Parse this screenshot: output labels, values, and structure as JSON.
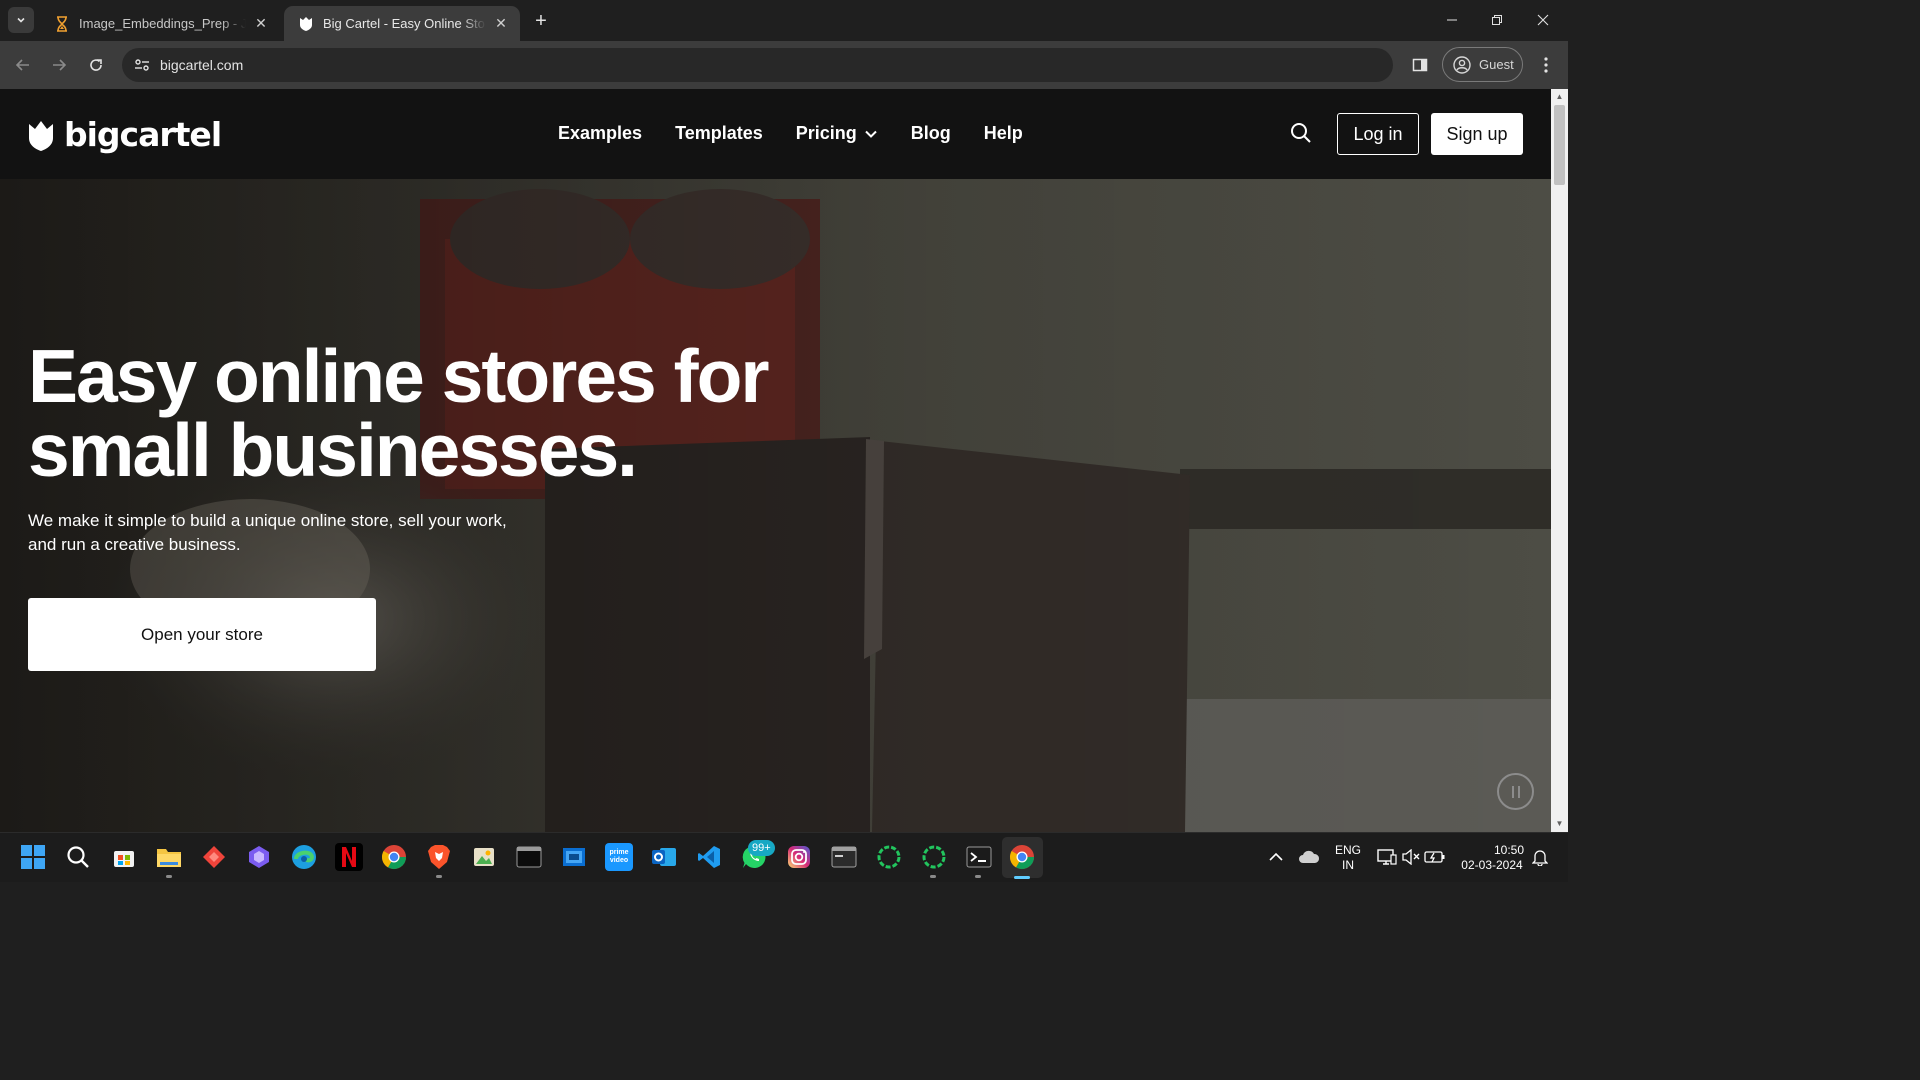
{
  "browser": {
    "tabs": [
      {
        "title": "Image_Embeddings_Prep - Jupy",
        "favicon": "hourglass-icon",
        "active": false
      },
      {
        "title": "Big Cartel - Easy Online Stores f",
        "favicon": "bigcartel-shield-icon",
        "active": true
      }
    ],
    "url": "bigcartel.com",
    "profile_label": "Guest"
  },
  "site": {
    "logo_text": "bigcartel",
    "nav": {
      "examples": "Examples",
      "templates": "Templates",
      "pricing": "Pricing",
      "blog": "Blog",
      "help": "Help"
    },
    "login_label": "Log in",
    "signup_label": "Sign up",
    "hero": {
      "title_line1": "Easy online stores for",
      "title_line2": "small businesses.",
      "subtitle_line1": "We make it simple to build a unique online store, sell your work,",
      "subtitle_line2": "and run a creative business.",
      "cta_label": "Open your store"
    }
  },
  "taskbar": {
    "whatsapp_badge": "99+",
    "language_line1": "ENG",
    "language_line2": "IN",
    "time": "10:50",
    "date": "02-03-2024"
  },
  "colors": {
    "header_bg": "#121212",
    "chrome_tabstrip": "#1f1f1f",
    "chrome_toolbar": "#3c3c3c",
    "button_white": "#ffffff",
    "taskbar_active": "#60cdff"
  }
}
